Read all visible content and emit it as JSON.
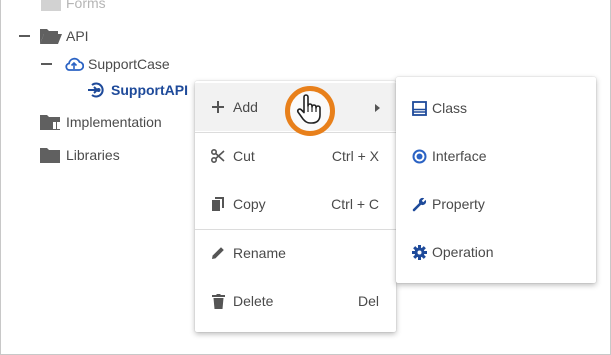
{
  "tree": {
    "forms": "Forms",
    "api": "API",
    "support_case": "SupportCase",
    "support_api": "SupportAPI",
    "implementation": "Implementation",
    "libraries": "Libraries"
  },
  "context_menu": {
    "add": "Add",
    "cut": "Cut",
    "cut_shortcut": "Ctrl + X",
    "copy": "Copy",
    "copy_shortcut": "Ctrl + C",
    "rename": "Rename",
    "delete": "Delete",
    "delete_shortcut": "Del"
  },
  "submenu": {
    "class": "Class",
    "interface": "Interface",
    "property": "Property",
    "operation": "Operation"
  },
  "colors": {
    "accent_blue": "#1e4a9a",
    "icon_blue": "#2b63c4",
    "highlight_orange": "#e8801b"
  },
  "icons": {
    "folder": "folder-icon",
    "folder_open": "folder-open-icon",
    "cloud": "cloud-icon",
    "port": "port-icon",
    "plus": "plus-icon",
    "scissors": "scissors-icon",
    "copy": "copy-icon",
    "pencil": "pencil-icon",
    "trash": "trash-icon",
    "class": "class-icon",
    "interface": "interface-icon",
    "wrench": "wrench-icon",
    "gear": "gear-icon",
    "hand_cursor": "hand-cursor-icon"
  }
}
